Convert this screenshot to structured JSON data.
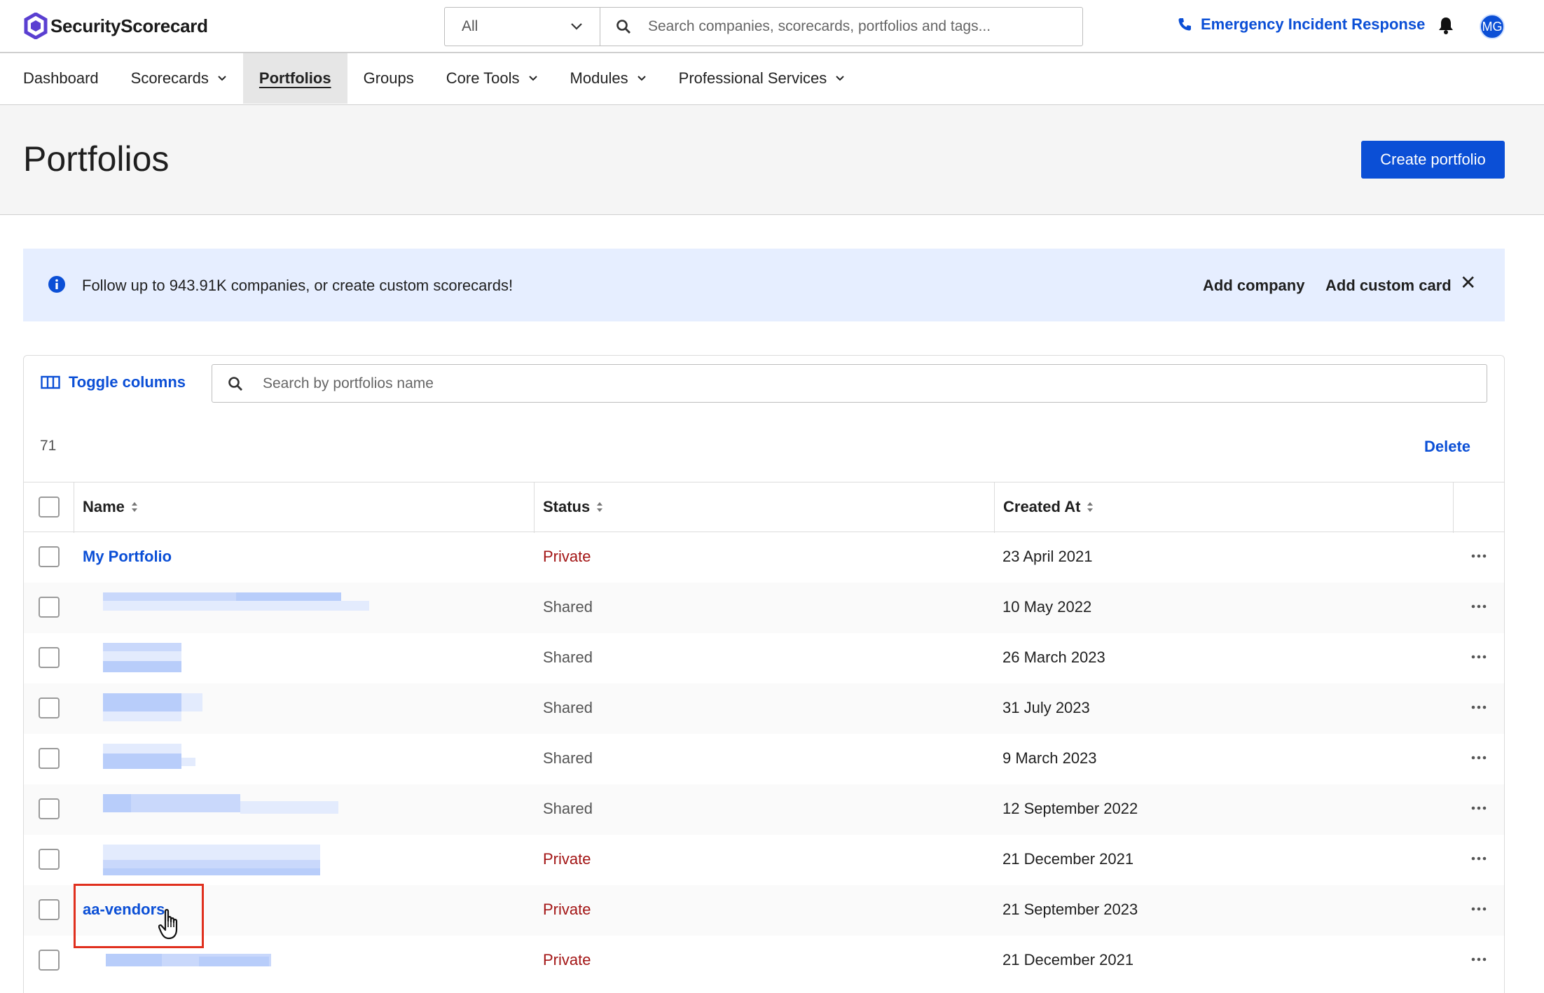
{
  "app": {
    "brand": "SecurityScorecard",
    "brand_color": "#5a3fd1",
    "accent": "#0b4fd6"
  },
  "topbar": {
    "scope_value": "All",
    "search_placeholder": "Search companies, scorecards, portfolios and tags...",
    "emergency_label": "Emergency Incident Response",
    "avatar_initials": "MG"
  },
  "nav": {
    "items": [
      {
        "label": "Dashboard",
        "has_menu": false,
        "active": false
      },
      {
        "label": "Scorecards",
        "has_menu": true,
        "active": false
      },
      {
        "label": "Portfolios",
        "has_menu": false,
        "active": true
      },
      {
        "label": "Groups",
        "has_menu": false,
        "active": false
      },
      {
        "label": "Core Tools",
        "has_menu": true,
        "active": false
      },
      {
        "label": "Modules",
        "has_menu": true,
        "active": false
      },
      {
        "label": "Professional Services",
        "has_menu": true,
        "active": false
      }
    ]
  },
  "header": {
    "title": "Portfolios",
    "create_label": "Create portfolio"
  },
  "banner": {
    "text": "Follow up to 943.91K companies, or create custom scorecards!",
    "add_company": "Add company",
    "add_custom_card": "Add custom card"
  },
  "table": {
    "toggle_columns": "Toggle columns",
    "search_placeholder": "Search by portfolios name",
    "count": "71",
    "delete_label": "Delete",
    "columns": [
      "Name",
      "Status",
      "Created At"
    ],
    "rows": [
      {
        "name": "My Portfolio",
        "status": "Private",
        "created": "23 April 2021",
        "redacted": false
      },
      {
        "name": "",
        "status": "Shared",
        "created": "10 May 2022",
        "redacted": true
      },
      {
        "name": "",
        "status": "Shared",
        "created": "26 March 2023",
        "redacted": true
      },
      {
        "name": "",
        "status": "Shared",
        "created": "31 July 2023",
        "redacted": true
      },
      {
        "name": "",
        "status": "Shared",
        "created": "9 March 2023",
        "redacted": true
      },
      {
        "name": "",
        "status": "Shared",
        "created": "12 September 2022",
        "redacted": true
      },
      {
        "name": "",
        "status": "Private",
        "created": "21 December 2021",
        "redacted": true
      },
      {
        "name": "aa-vendors",
        "status": "Private",
        "created": "21 September 2023",
        "redacted": false
      },
      {
        "name": "",
        "status": "Private",
        "created": "21 December 2021",
        "redacted": true
      }
    ]
  }
}
